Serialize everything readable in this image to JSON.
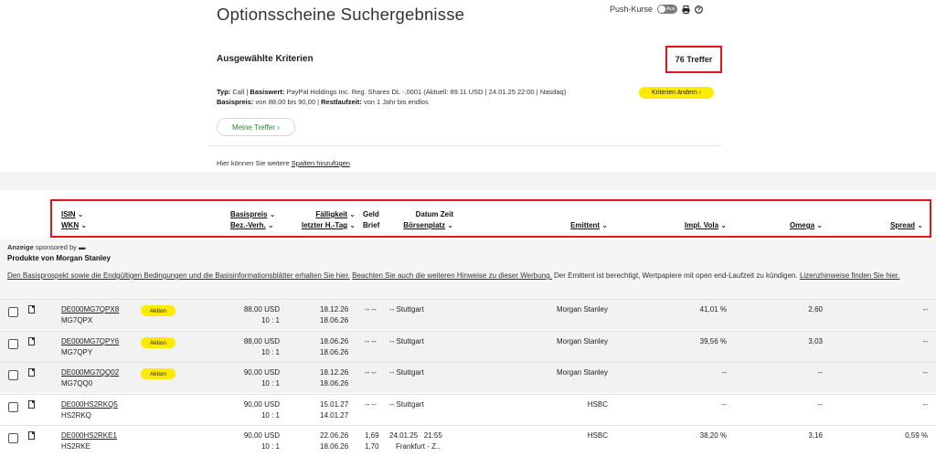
{
  "page": {
    "title": "Optionsscheine Suchergebnisse",
    "push_label": "Push-Kurse",
    "push_toggle": "Aus"
  },
  "criteria": {
    "heading": "Ausgewählte Kriterien",
    "treffer": "76 Treffer",
    "typ_label": "Typ:",
    "typ_value": "Call",
    "basiswert_label": "Basiswert:",
    "basiswert_value": "PayPal Holdings Inc. Reg. Shares DL -,0001 (Aktuell: 89.11 USD | 24.01.25 22:00 | Nasdaq)",
    "basispreis_label": "Basispreis:",
    "basispreis_value": "von 88,00 bis 90,00",
    "restlaufzeit_label": "Restlaufzeit:",
    "restlaufzeit_value": "von 1 Jahr bis endlos",
    "change_button": "Kriterien ändern",
    "meine_treffer": "Meine Treffer",
    "hint_prefix": "Hier können Sie weitere",
    "hint_link": "Spalten hinzufügen"
  },
  "table_header": {
    "isin": "ISIN",
    "wkn": "WKN",
    "basispreis": "Basispreis",
    "bezverh": "Bez.-Verh.",
    "faelligkeit": "Fälligkeit",
    "letzter_htag": "letzter H.-Tag",
    "geld": "Geld",
    "brief": "Brief",
    "datum_zeit": "Datum Zeit",
    "boersenplatz": "Börsenplatz",
    "emittent": "Emittent",
    "impl_vola": "Impl. Vola",
    "omega": "Omega",
    "spread": "Spread"
  },
  "sponsor": {
    "line1": "Anzeige",
    "line1b": "sponsored by",
    "line2": "Produkte von Morgan Stanley",
    "text1": "Den Basisprospekt sowie die Endgültigen Bedingungen und die Basisinformationsblätter erhalten Sie hier.",
    "text2": "Beachten Sie auch die weiteren Hinweise zu dieser Werbung.",
    "text3": "Der Emittent ist berechtigt, Wertpapiere mit open end-Laufzeit zu kündigen.",
    "text4": "Lizenzhinweise finden Sie hier."
  },
  "rows": [
    {
      "isin": "DE000MG7QPX8",
      "wkn": "MG7QPX",
      "aktion": "Aktion",
      "basispreis": "88,00 USD",
      "bezverh": "10 : 1",
      "faellig": "18.12.26",
      "letzter": "18.06.26",
      "geld": "-- --",
      "brief": "",
      "datum": "-- Stuttgart",
      "platz": "",
      "emittent": "Morgan Stanley",
      "vola": "41,01 %",
      "omega": "2,60",
      "spread": "--"
    },
    {
      "isin": "DE000MG7QPY6",
      "wkn": "MG7QPY",
      "aktion": "Aktion",
      "basispreis": "88,00 USD",
      "bezverh": "10 : 1",
      "faellig": "18.06.26",
      "letzter": "18.06.26",
      "geld": "-- --",
      "brief": "",
      "datum": "-- Stuttgart",
      "platz": "",
      "emittent": "Morgan Stanley",
      "vola": "39,56 %",
      "omega": "3,03",
      "spread": "--"
    },
    {
      "isin": "DE000MG7QQ02",
      "wkn": "MG7QQ0",
      "aktion": "Aktion",
      "basispreis": "90,00 USD",
      "bezverh": "10 : 1",
      "faellig": "18.12.26",
      "letzter": "18.06.26",
      "geld": "-- --",
      "brief": "",
      "datum": "-- Stuttgart",
      "platz": "",
      "emittent": "Morgan Stanley",
      "vola": "--",
      "omega": "--",
      "spread": "--"
    },
    {
      "isin": "DE000HS2RKQ5",
      "wkn": "HS2RKQ",
      "aktion": "",
      "basispreis": "90,00 USD",
      "bezverh": "10 : 1",
      "faellig": "15.01.27",
      "letzter": "14.01.27",
      "geld": "-- --",
      "brief": "",
      "datum": "-- Stuttgart",
      "platz": "",
      "emittent": "HSBC",
      "vola": "--",
      "omega": "--",
      "spread": "--"
    },
    {
      "isin": "DE000HS2RKE1",
      "wkn": "HS2RKE",
      "aktion": "",
      "basispreis": "90,00 USD",
      "bezverh": "10 : 1",
      "faellig": "22.06.26",
      "letzter": "18.06.26",
      "geld": "1,69",
      "brief": "1,70",
      "datum": "24.01.25   21:55",
      "platz": "Frankfurt - Z..",
      "emittent": "HSBC",
      "vola": "38,20 %",
      "omega": "3,16",
      "spread": "0,59 %"
    }
  ]
}
